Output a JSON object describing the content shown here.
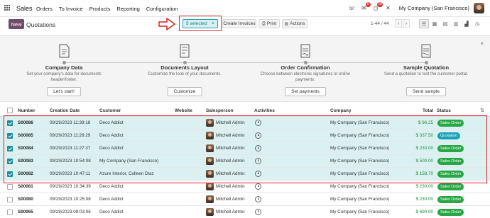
{
  "nav": {
    "app_name": "Sales",
    "menu": [
      "Orders",
      "To Invoice",
      "Products",
      "Reporting",
      "Configuration"
    ],
    "badges": {
      "messages": "8",
      "activities": "28"
    },
    "company": "My Company (San Francisco)"
  },
  "control": {
    "new_label": "New",
    "title": "Quotations",
    "selected_label": "5 selected",
    "selected_close": "×",
    "create_invoices_label": "Create Invoices",
    "print_label": "Print",
    "actions_label": "Actions",
    "pager_label": "1-44 / 44",
    "pager_prev": "‹",
    "pager_next": "›"
  },
  "onboarding": {
    "steps": [
      {
        "title": "Company Data",
        "desc": "Set your company's data for documents header/footer.",
        "button": "Let's start!"
      },
      {
        "title": "Documents Layout",
        "desc": "Customize the look of your documents.",
        "button": "Customize"
      },
      {
        "title": "Order Confirmation",
        "desc": "Choose between electronic signatures or online payments.",
        "button": "Set payments"
      },
      {
        "title": "Sample Quotation",
        "desc": "Send a quotation to test the customer portal.",
        "button": "Send sample"
      }
    ],
    "close": "×"
  },
  "table": {
    "headers": {
      "number": "Number",
      "creation_date": "Creation Date",
      "customer": "Customer",
      "website": "Website",
      "salesperson": "Salesperson",
      "activities": "Activities",
      "company": "Company",
      "total": "Total",
      "status": "Status"
    },
    "rows": [
      {
        "selected": true,
        "number": "S00086",
        "date": "09/29/2023 11:39:18",
        "customer": "Deco Addict",
        "salesperson": "Mitchell Admin",
        "company": "My Company (San Francisco)",
        "total": "$ 96.25",
        "status": "Sales Order"
      },
      {
        "selected": true,
        "number": "S00085",
        "date": "09/29/2023 11:28:29",
        "customer": "Deco Addict",
        "salesperson": "Mitchell Admin",
        "company": "My Company (San Francisco)",
        "total": "$ 337.50",
        "status": "Quotation"
      },
      {
        "selected": true,
        "number": "S00084",
        "date": "09/29/2023 11:27:37",
        "customer": "Deco Addict",
        "salesperson": "Mitchell Admin",
        "company": "My Company (San Francisco)",
        "total": "$ 230.00",
        "status": "Sales Order"
      },
      {
        "selected": true,
        "number": "S00083",
        "date": "09/29/2023 10:54:08",
        "customer": "My Company (San Francisco)",
        "salesperson": "Mitchell Admin",
        "company": "My Company (San Francisco)",
        "total": "$ 500.00",
        "status": "Sales Order"
      },
      {
        "selected": true,
        "number": "S00082",
        "date": "09/29/2023 10:47:11",
        "customer": "Azure Interior, Colleen Diaz",
        "salesperson": "Mitchell Admin",
        "company": "My Company (San Francisco)",
        "total": "$ 158.70",
        "status": "Sales Order"
      },
      {
        "selected": false,
        "number": "S00081",
        "date": "09/29/2023 10:34:39",
        "customer": "Deco Addict",
        "salesperson": "Mitchell Admin",
        "company": "My Company (San Francisco)",
        "total": "$ 230.00",
        "status": "Sales Order"
      },
      {
        "selected": false,
        "number": "S00080",
        "date": "09/29/2023 10:25:08",
        "customer": "Deco Addict",
        "salesperson": "Mitchell Admin",
        "company": "My Company (San Francisco)",
        "total": "$ 230.00",
        "status": "Sales Order"
      },
      {
        "selected": false,
        "number": "S00065",
        "date": "09/29/2023 08:03:06",
        "customer": "Deco Addict",
        "salesperson": "Mitchell Admin",
        "company": "My Company (San Francisco)",
        "total": "$ 690.00",
        "status": "Sales Order"
      }
    ]
  },
  "colors": {
    "brand": "#714b67",
    "accent": "#1a8e9a",
    "annotation": "#dd2222",
    "sales_order": "#28a745",
    "quotation": "#17a2b8"
  }
}
